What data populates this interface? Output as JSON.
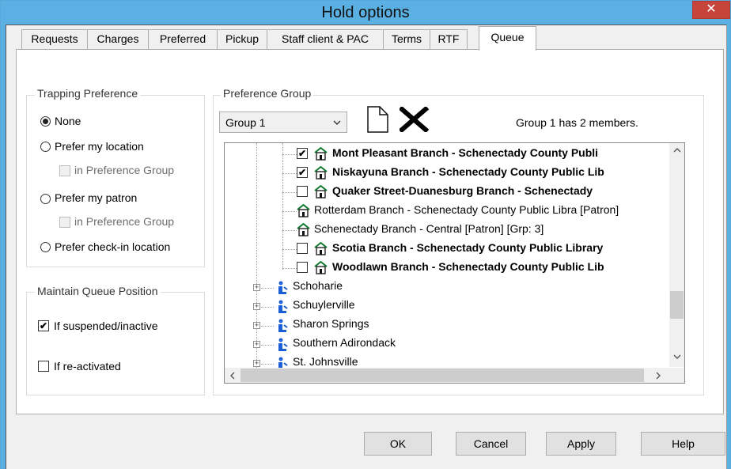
{
  "window": {
    "title": "Hold options",
    "close_glyph": "✕"
  },
  "tabs": [
    {
      "label": "Requests"
    },
    {
      "label": "Charges"
    },
    {
      "label": "Preferred"
    },
    {
      "label": "Pickup"
    },
    {
      "label": "Staff client & PAC"
    },
    {
      "label": "Terms"
    },
    {
      "label": "RTF"
    },
    {
      "label": "Queue"
    }
  ],
  "active_tab": "Queue",
  "trapping": {
    "legend": "Trapping Preference",
    "none": "None",
    "prefer_location": "Prefer my location",
    "in_group_1": "in Preference Group",
    "prefer_patron": "Prefer my patron",
    "in_group_2": "in Preference Group",
    "prefer_checkin": "Prefer check-in location",
    "selected": "None"
  },
  "queue_position": {
    "legend": "Maintain Queue Position",
    "if_suspended": "If suspended/inactive",
    "if_suspended_checked": true,
    "if_reactivated": "If re-activated",
    "if_reactivated_checked": false
  },
  "preference_group": {
    "legend": "Preference Group",
    "selected_group": "Group 1",
    "member_info": "Group 1 has 2 members.",
    "new_icon": "new-document-icon",
    "delete_icon": "delete-x-icon"
  },
  "tree": {
    "branches": [
      {
        "label": "Mont Pleasant Branch - Schenectady County Publi",
        "checked": true,
        "bold": true,
        "checkbox": true
      },
      {
        "label": "Niskayuna Branch - Schenectady County Public Lib",
        "checked": true,
        "bold": true,
        "checkbox": true
      },
      {
        "label": "Quaker Street-Duanesburg Branch - Schenectady",
        "checked": false,
        "bold": true,
        "checkbox": true
      },
      {
        "label": "Rotterdam Branch - Schenectady County Public Libra [Patron]",
        "checked": false,
        "bold": false,
        "checkbox": false
      },
      {
        "label": "Schenectady Branch - Central [Patron] [Grp: 3]",
        "checked": false,
        "bold": false,
        "checkbox": false
      },
      {
        "label": "Scotia Branch - Schenectady County Public Library",
        "checked": false,
        "bold": true,
        "checkbox": true
      },
      {
        "label": "Woodlawn Branch - Schenectady County Public Lib",
        "checked": false,
        "bold": true,
        "checkbox": true
      }
    ],
    "systems": [
      {
        "label": "Schoharie"
      },
      {
        "label": "Schuylerville"
      },
      {
        "label": "Sharon Springs"
      },
      {
        "label": "Southern Adirondack"
      },
      {
        "label": "St. Johnsville"
      }
    ],
    "branch_icon": "library-building-icon",
    "system_icon": "organization-icon",
    "scroll_up": "^",
    "scroll_down": "v",
    "scroll_left": "<",
    "scroll_right": ">"
  },
  "buttons": {
    "ok": "OK",
    "cancel": "Cancel",
    "apply": "Apply",
    "help": "Help"
  },
  "colors": {
    "titlebar": "#5ab0e3",
    "close": "#c7443a",
    "system_icon": "#1a5fd6",
    "branch_roof": "#0d7a2f"
  }
}
